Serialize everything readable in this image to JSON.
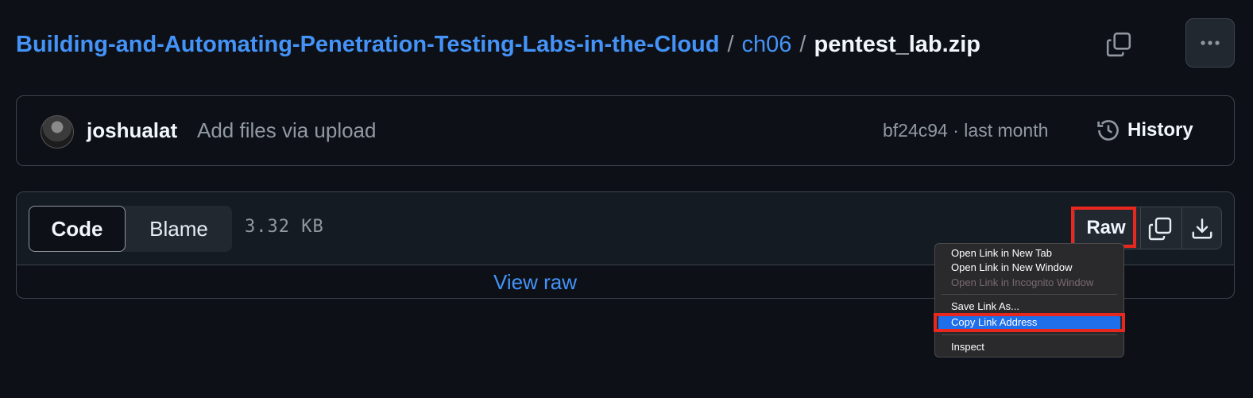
{
  "breadcrumb": {
    "repo": "Building-and-Automating-Penetration-Testing-Labs-in-the-Cloud",
    "separator": "/",
    "folder": "ch06",
    "file": "pentest_lab.zip"
  },
  "icons": {
    "copy_path": "copy-icon",
    "more": "kebab-horizontal-icon",
    "history": "history-icon",
    "copy_raw": "copy-icon",
    "download": "download-icon"
  },
  "commit": {
    "author": "joshualat",
    "message": "Add files via upload",
    "sha_time": "bf24c94 · last month",
    "history_label": "History"
  },
  "file": {
    "tabs": [
      "Code",
      "Blame"
    ],
    "active_tab": "Code",
    "size": "3.32 KB",
    "raw_label": "Raw",
    "view_raw": "View raw"
  },
  "context_menu": {
    "items": [
      {
        "label": "Open Link in New Tab",
        "enabled": true
      },
      {
        "label": "Open Link in New Window",
        "enabled": true
      },
      {
        "label": "Open Link in Incognito Window",
        "enabled": false
      },
      {
        "label": "Save Link As...",
        "enabled": true
      },
      {
        "label": "Copy Link Address",
        "enabled": true,
        "selected": true
      },
      {
        "label": "Inspect",
        "enabled": true
      }
    ]
  },
  "colors": {
    "background": "#0d1117",
    "link": "#4493f8",
    "annotation_highlight": "#e8281e",
    "menu_selection": "#1f6feb"
  }
}
